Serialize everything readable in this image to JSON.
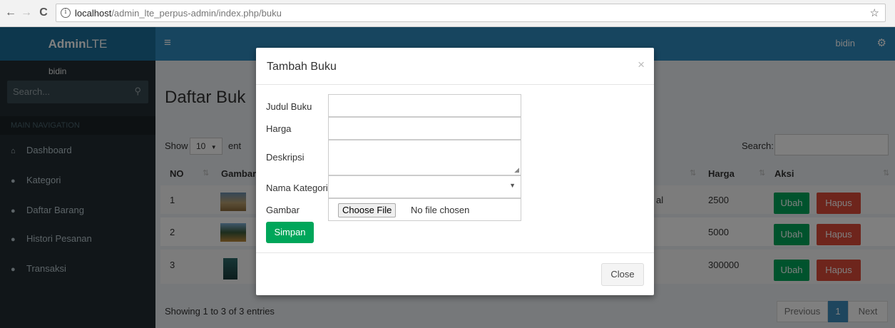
{
  "browser": {
    "back_icon": "←",
    "forward_icon": "→",
    "reload_icon": "C",
    "info_icon": "i",
    "url_host": "localhost",
    "url_path": "/admin_lte_perpus-admin/index.php/buku",
    "star_icon": "☆"
  },
  "header": {
    "logo_bold": "Admin",
    "logo_rest": "LTE",
    "hamburger_icon": "≡",
    "user": "bidin",
    "gears_icon": "⚙"
  },
  "sidebar": {
    "user": "bidin",
    "search_placeholder": "Search...",
    "search_icon": "⚲",
    "nav_header": "MAIN NAVIGATION",
    "items": [
      {
        "icon": "⌂",
        "label": "Dashboard"
      },
      {
        "icon": "●",
        "label": "Kategori"
      },
      {
        "icon": "●",
        "label": "Daftar Barang"
      },
      {
        "icon": "●",
        "label": "Histori Pesanan"
      },
      {
        "icon": "●",
        "label": "Transaksi"
      }
    ]
  },
  "main": {
    "title": "Daftar Buk",
    "show_label": "Show",
    "show_value": "10",
    "show_after": "ent",
    "search_label": "Search:",
    "columns": [
      "NO",
      "Gambar",
      "Harga",
      "Aksi"
    ],
    "rows": [
      {
        "no": "1",
        "partial": "al",
        "harga": "2500",
        "ubah": "Ubah",
        "hapus": "Hapus"
      },
      {
        "no": "2",
        "partial": "",
        "harga": "5000",
        "ubah": "Ubah",
        "hapus": "Hapus"
      },
      {
        "no": "3",
        "partial": "",
        "harga": "300000",
        "ubah": "Ubah",
        "hapus": "Hapus"
      }
    ],
    "footer_info": "Showing 1 to 3 of 3 entries",
    "pager": {
      "previous": "Previous",
      "page": "1",
      "next": "Next"
    }
  },
  "modal": {
    "title": "Tambah Buku",
    "close_x": "×",
    "fields": {
      "judul_label": "Judul Buku",
      "harga_label": "Harga",
      "deskripsi_label": "Deskripsi",
      "kategori_label": "Nama Kategori",
      "gambar_label": "Gambar",
      "choose_file": "Choose File",
      "no_file": "No file chosen"
    },
    "simpan": "Simpan",
    "close": "Close"
  },
  "colors": {
    "logo_bg": "#1a6f9b",
    "topbar_bg": "#2f8bbf",
    "sidebar_bg": "#222d32",
    "success": "#00a65a",
    "danger": "#dd4b39",
    "primary": "#3c8dbc"
  }
}
